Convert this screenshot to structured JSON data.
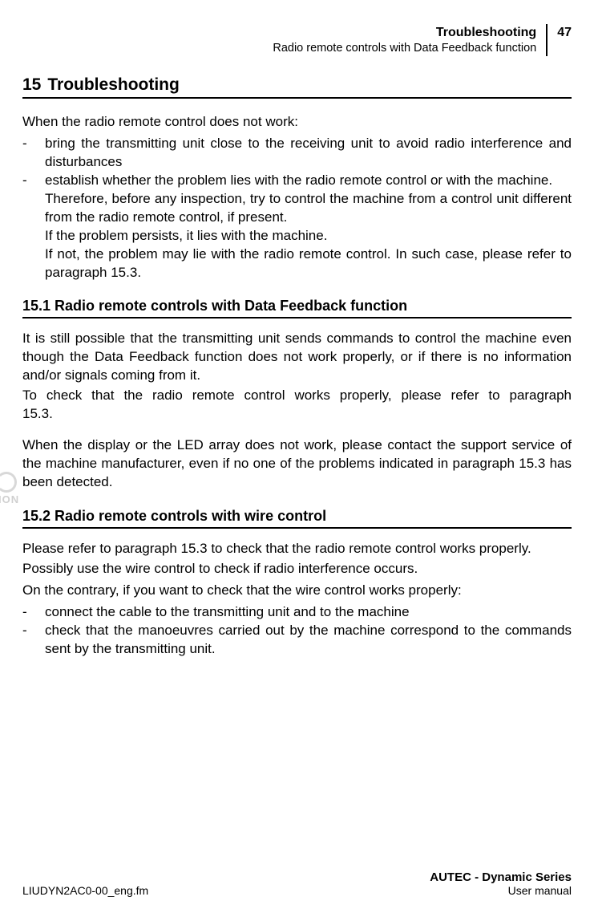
{
  "header": {
    "title": "Troubleshooting",
    "subtitle": "Radio remote controls with Data Feedback function",
    "page_number": "47"
  },
  "section": {
    "number": "15",
    "title": "Troubleshooting"
  },
  "intro_text": "When the radio remote control does not work:",
  "list1": {
    "item1": "bring the transmitting unit close to the receiving unit to avoid radio interference and disturbances",
    "item2_line1": "establish whether the problem lies with the radio remote control or with the machine.",
    "item2_line2": "Therefore, before any inspection, try to control the machine from a control unit different from the radio remote control, if present.",
    "item2_line3": "If the problem persists, it lies with the machine.",
    "item2_line4": "If not, the problem may lie with the radio remote control. In such case, please refer to paragraph 15.3."
  },
  "subsection1": {
    "heading": "15.1 Radio remote controls with Data Feedback function",
    "para1": "It is still possible that the transmitting unit sends commands to control the machine even though the Data Feedback function does not work properly, or if there is no information and/or signals coming from it.",
    "para2": "To check that the radio remote control works properly, please refer to paragraph 15.3.",
    "para3": "When the display or the LED array does not work, please contact the support service of the machine manufacturer, even if no one of the problems indicated in paragraph 15.3 has been detected."
  },
  "subsection2": {
    "heading": "15.2 Radio remote controls with wire control",
    "para1": "Please refer to paragraph 15.3 to check that the radio remote control works properly.",
    "para2": "Possibly use the wire control to check if radio interference occurs.",
    "para3": "On the contrary, if you want to check that the wire control works properly:",
    "item1": "connect the cable to the transmitting unit and to the machine",
    "item2": "check that the manoeuvres carried out by the machine correspond to the commands sent by the transmitting unit."
  },
  "watermark": "ION",
  "footer": {
    "left": "LIUDYN2AC0-00_eng.fm",
    "series": "AUTEC - Dynamic Series",
    "manual": "User manual"
  }
}
